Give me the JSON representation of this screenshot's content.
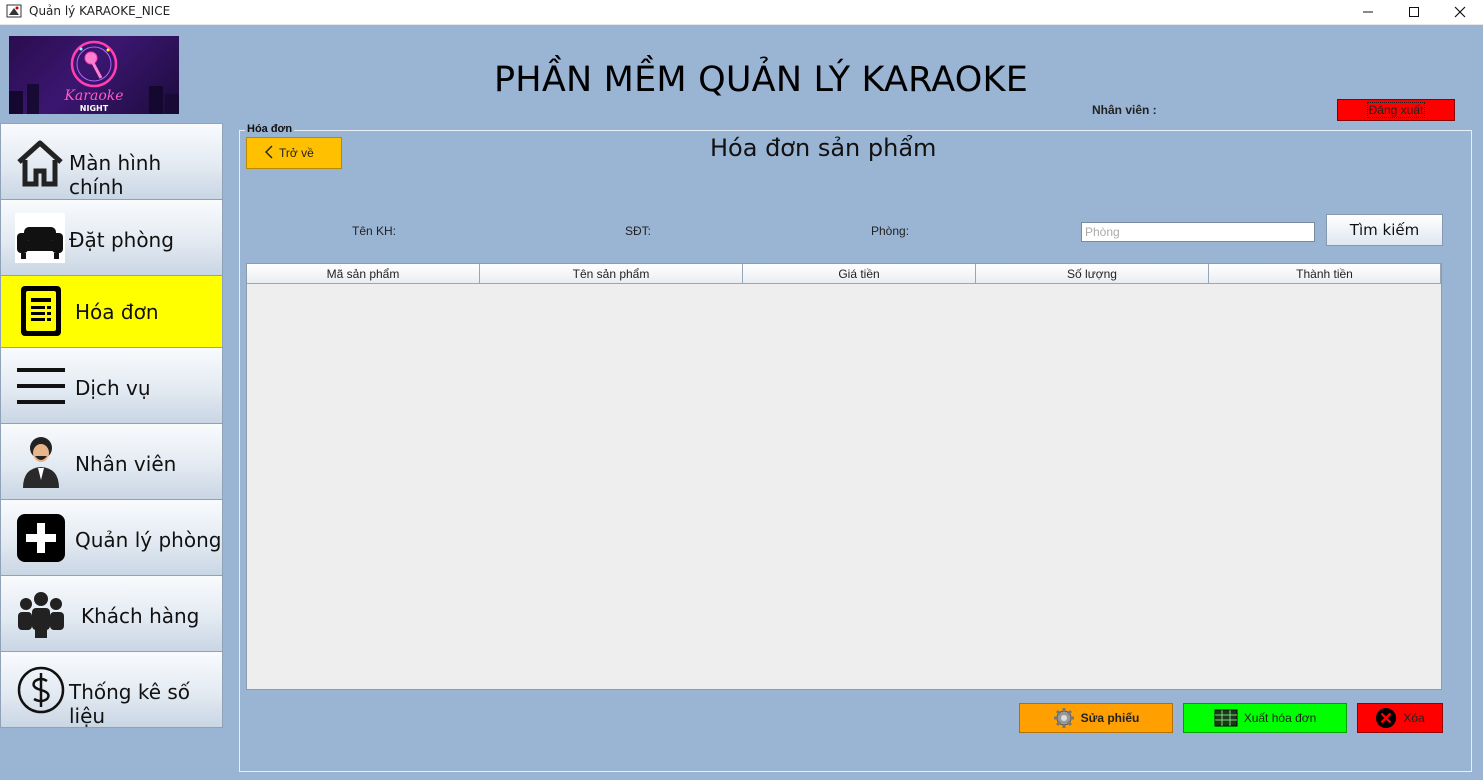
{
  "window": {
    "title": "Quản lý KARAOKE_NICE"
  },
  "logo": {
    "line1": "Karaoke",
    "line2": "NIGHT"
  },
  "header": {
    "app_title": "PHẦN MỀM QUẢN LÝ KARAOKE",
    "staff_label": "Nhân viên :",
    "logout_label": "Đăng xuất"
  },
  "sidebar": {
    "items": [
      {
        "label": "Màn hình chính",
        "icon": "home-icon"
      },
      {
        "label": "Đặt phòng",
        "icon": "sofa-icon"
      },
      {
        "label": "Hóa đơn",
        "icon": "invoice-icon",
        "active": true
      },
      {
        "label": "Dịch vụ",
        "icon": "menu-lines-icon"
      },
      {
        "label": "Nhân viên",
        "icon": "employee-icon"
      },
      {
        "label": "Quản lý phòng",
        "icon": "plus-icon"
      },
      {
        "label": "Khách hàng",
        "icon": "people-icon"
      },
      {
        "label": "Thống kê số liệu",
        "icon": "dollar-icon"
      }
    ]
  },
  "panel": {
    "legend": "Hóa đơn",
    "back_label": "Trở về",
    "title": "Hóa đơn sản phẩm",
    "fields": {
      "customer_label": "Tên KH:",
      "phone_label": "SĐT:",
      "room_label": "Phòng:",
      "room_placeholder": "Phòng"
    },
    "search_label": "Tìm kiếm",
    "table": {
      "columns": [
        "Mã sản phẩm",
        "Tên sản phẩm",
        "Giá tiền",
        "Số lượng",
        "Thành tiền"
      ],
      "rows": []
    },
    "actions": {
      "edit_label": "Sửa phiếu",
      "export_label": "Xuất hóa đơn",
      "delete_label": "Xóa"
    }
  },
  "colors": {
    "background": "#9ab4d4",
    "active_nav": "#ffff00",
    "logout": "#ff0000",
    "back": "#ffc000",
    "edit": "#ff9f00",
    "export": "#00ff00",
    "delete": "#ff0000"
  }
}
